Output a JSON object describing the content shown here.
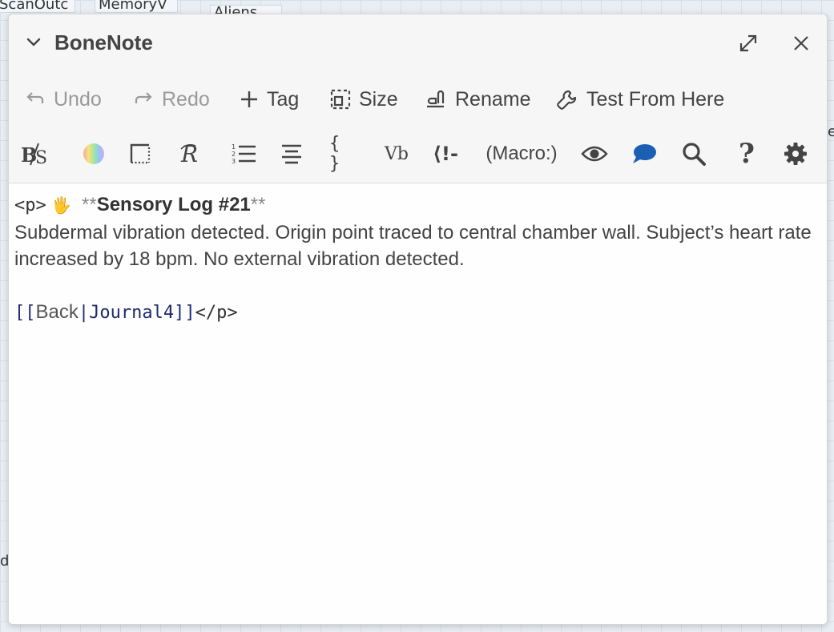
{
  "background": {
    "passages": [
      "ScanOutc",
      "MemoryV",
      "Aliens"
    ],
    "fragments": [
      "er",
      "d"
    ]
  },
  "dialog": {
    "title": "BoneNote"
  },
  "toolbar": {
    "undo": "Undo",
    "redo": "Redo",
    "tag": "Tag",
    "size": "Size",
    "rename": "Rename",
    "test_from_here": "Test From Here"
  },
  "format_toolbar": {
    "macro": "(Macro:)",
    "vb": "Vb",
    "braces": "{ }",
    "question": "?",
    "collapse_whitespace": "⟨!-"
  },
  "editor": {
    "open_tag": "<p>",
    "emoji": "🖐",
    "bold_open": "**",
    "heading": "Sensory Log #21",
    "bold_close": "**",
    "body_text": "Subdermal vibration detected. Origin point traced to central chamber wall. Subject’s heart rate increased by 18 bpm. No external vibration detected.",
    "link_open": "[[",
    "link_label": "Back",
    "link_sep": "|",
    "link_target": "Journal4",
    "link_close": "]]",
    "close_tag": "</p>"
  },
  "colors": {
    "accent_blue": "#1a5fb4",
    "text": "#444444",
    "disabled": "#9a9a9a"
  }
}
